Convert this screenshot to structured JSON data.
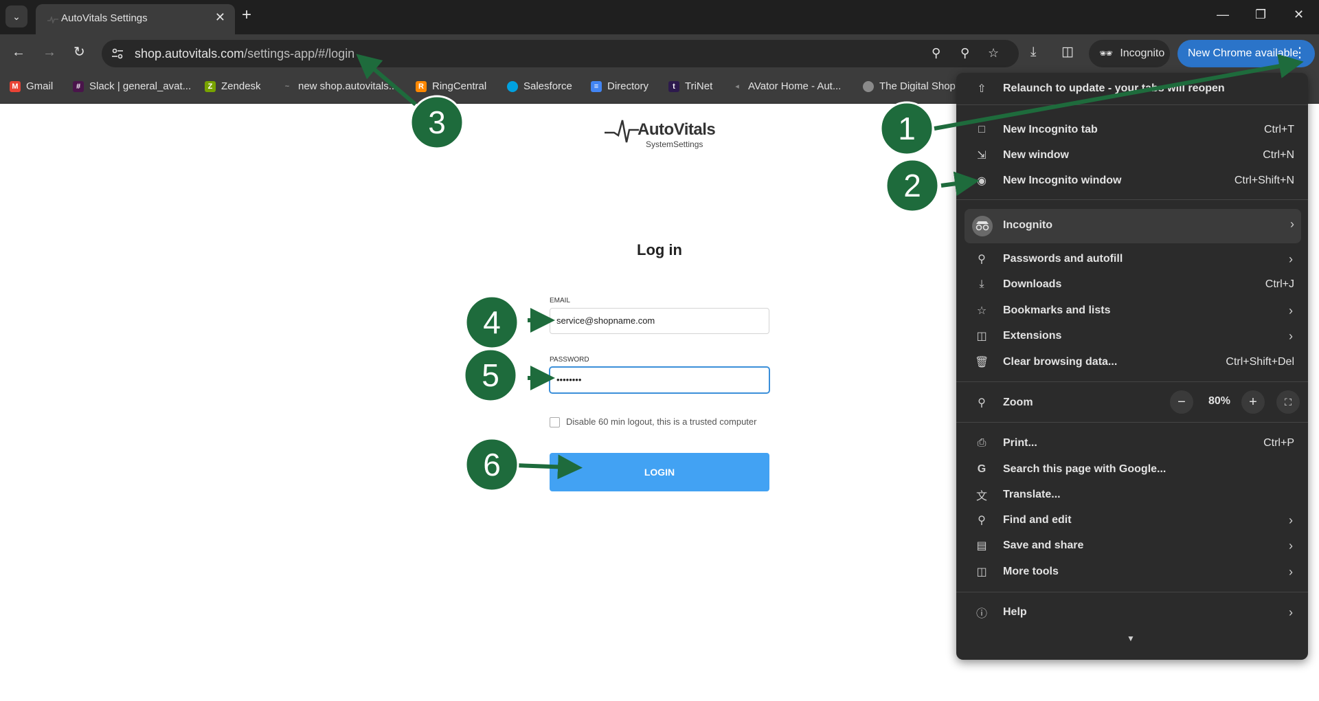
{
  "browser": {
    "tab_title": "AutoVitals Settings",
    "url_domain": "shop.autovitals.com",
    "url_path": "/settings-app/#/login",
    "incognito_label": "Incognito",
    "update_label": "New Chrome available"
  },
  "bookmarks": [
    {
      "label": "Gmail",
      "icon": "gmail-icon",
      "color": "#ea4335"
    },
    {
      "label": "Slack | general_avat...",
      "icon": "slack-icon",
      "color": "#4a154b"
    },
    {
      "label": "Zendesk",
      "icon": "zendesk-icon",
      "color": "#78a300"
    },
    {
      "label": "new shop.autovitals...",
      "icon": "autovitals-icon",
      "color": "#888888"
    },
    {
      "label": "RingCentral",
      "icon": "ringcentral-icon",
      "color": "#ff8800"
    },
    {
      "label": "Salesforce",
      "icon": "salesforce-icon",
      "color": "#00a1e0"
    },
    {
      "label": "Directory",
      "icon": "docs-icon",
      "color": "#4285f4"
    },
    {
      "label": "TriNet",
      "icon": "trinet-icon",
      "color": "#2d1a4d"
    },
    {
      "label": "AVator Home - Aut...",
      "icon": "avator-icon",
      "color": "#888888"
    },
    {
      "label": "The Digital Shop",
      "icon": "globe-icon",
      "color": "#888888"
    }
  ],
  "page": {
    "logo_text": "AutoVitals",
    "logo_sub": "SystemSettings",
    "title": "Log in",
    "email_label": "EMAIL",
    "email_value": "service@shopname.com",
    "password_label": "PASSWORD",
    "password_value": "••••••••",
    "trusted_label": "Disable 60 min logout, this is a trusted computer",
    "login_label": "LOGIN"
  },
  "menu": {
    "relaunch": "Relaunch to update - your tabs will reopen",
    "new_incognito_tab": {
      "label": "New Incognito tab",
      "shortcut": "Ctrl+T"
    },
    "new_window": {
      "label": "New window",
      "shortcut": "Ctrl+N"
    },
    "new_incognito_window": {
      "label": "New Incognito window",
      "shortcut": "Ctrl+Shift+N"
    },
    "incognito": "Incognito",
    "passwords": "Passwords and autofill",
    "downloads": {
      "label": "Downloads",
      "shortcut": "Ctrl+J"
    },
    "bookmarks": "Bookmarks and lists",
    "extensions": "Extensions",
    "clear_data": {
      "label": "Clear browsing data...",
      "shortcut": "Ctrl+Shift+Del"
    },
    "zoom": {
      "label": "Zoom",
      "value": "80%"
    },
    "print": {
      "label": "Print...",
      "shortcut": "Ctrl+P"
    },
    "search_google": "Search this page with Google...",
    "translate": "Translate...",
    "find_edit": "Find and edit",
    "save_share": "Save and share",
    "more_tools": "More tools",
    "help": "Help"
  },
  "annotations": {
    "step_1": "1",
    "step_2": "2",
    "step_3": "3",
    "step_4": "4",
    "step_5": "5",
    "step_6": "6",
    "badge_color": "#1e6b3c"
  }
}
